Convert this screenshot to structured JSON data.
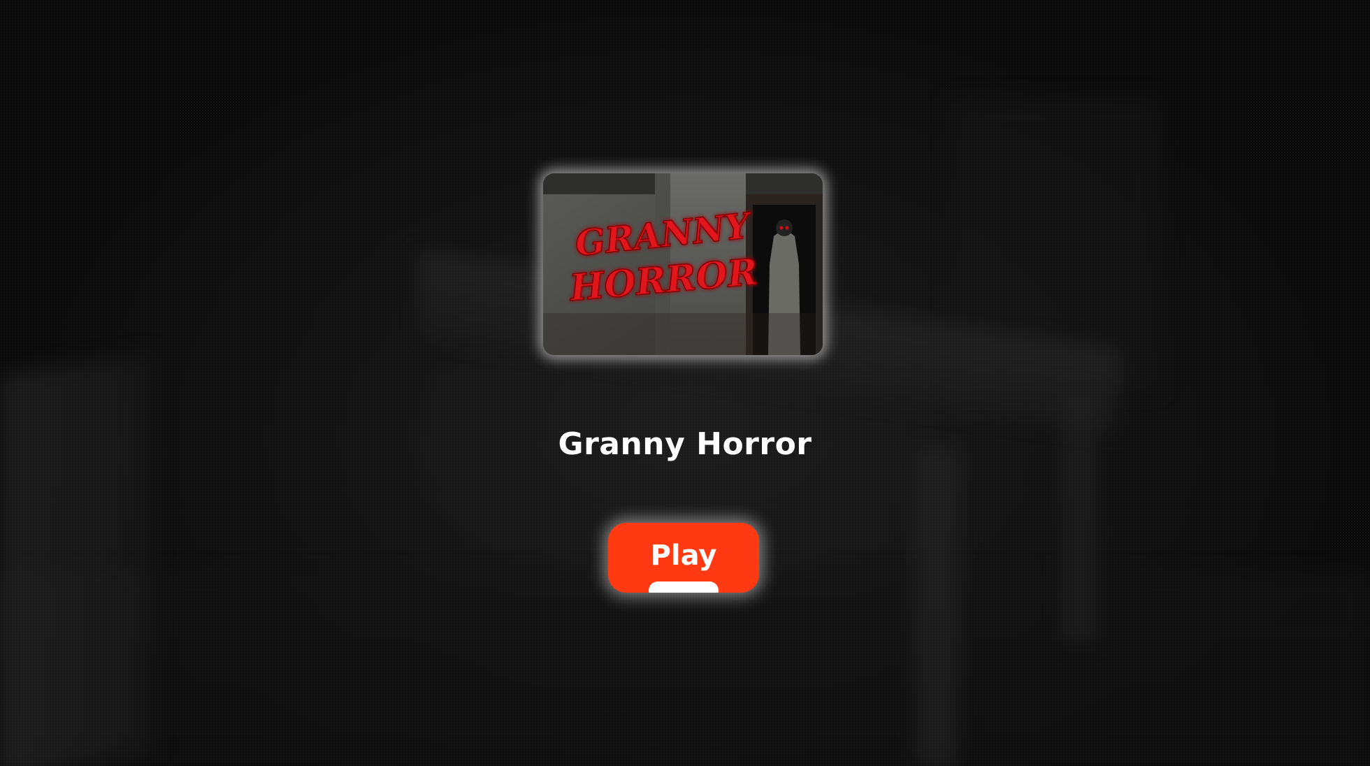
{
  "game": {
    "title": "Granny Horror",
    "thumbnail_logo_line1": "GRANNY",
    "thumbnail_logo_line2": "HORROR"
  },
  "play_button": {
    "label": "Play"
  },
  "colors": {
    "accent": "#ff3a12",
    "logo_red": "#e0121c",
    "text": "#ffffff"
  }
}
